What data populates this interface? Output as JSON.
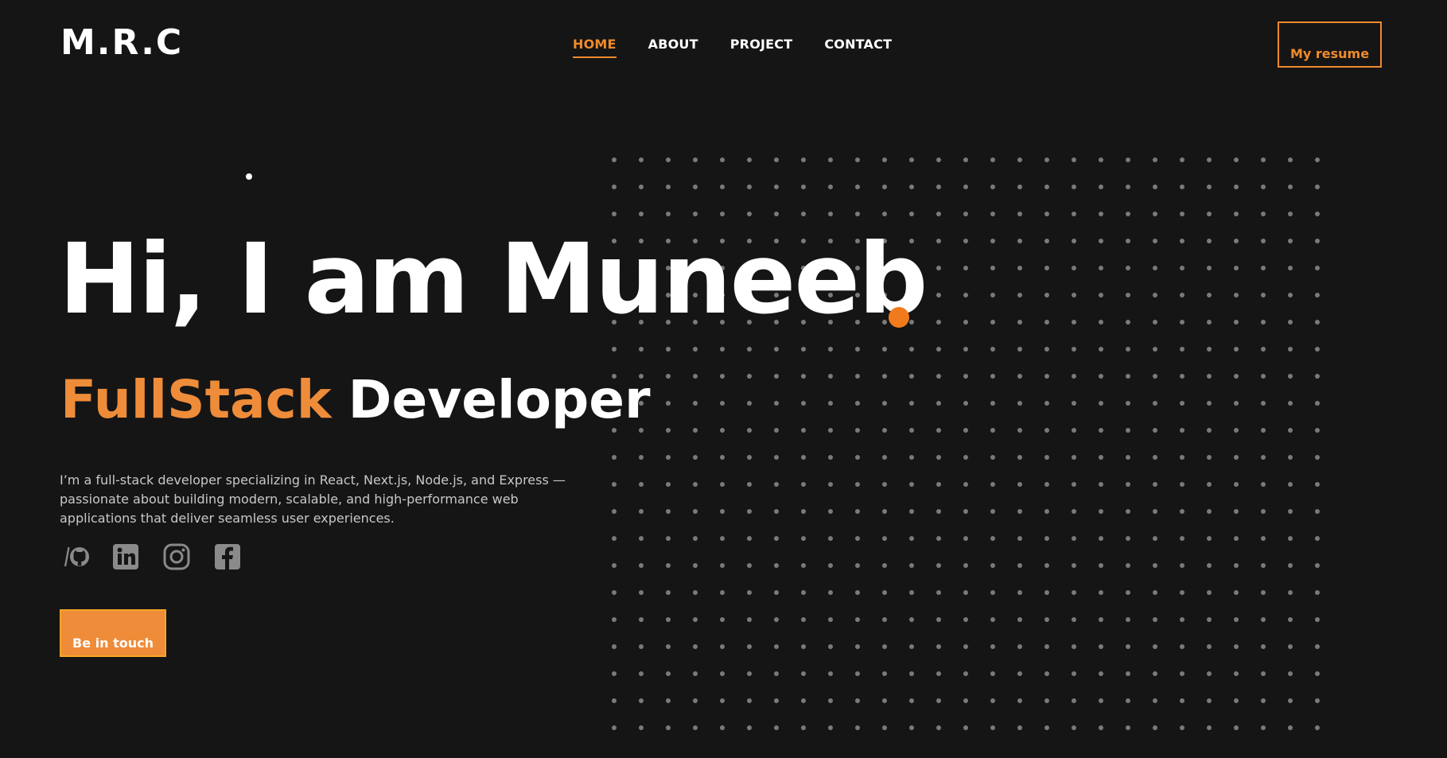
{
  "header": {
    "logo": "M.R.C",
    "nav": [
      {
        "label": "HOME",
        "active": true
      },
      {
        "label": "ABOUT",
        "active": false
      },
      {
        "label": "PROJECT",
        "active": false
      },
      {
        "label": "CONTACT",
        "active": false
      }
    ],
    "resume_label": "My resume"
  },
  "hero": {
    "title": "Hi, I am Muneeb",
    "subtitle_accent": "FullStack",
    "subtitle_plain": "Developer",
    "description": "I’m a full-stack developer specializing in React, Next.js, Node.js, and Express — passionate about building modern, scalable, and high-performance web applications that deliver seamless user experiences.",
    "socials": [
      {
        "icon": "github-icon"
      },
      {
        "icon": "linkedin-icon"
      },
      {
        "icon": "instagram-icon"
      },
      {
        "icon": "facebook-icon"
      }
    ],
    "cta_label": "Be in touch"
  },
  "colors": {
    "background": "#151516",
    "accent": "#ee8c3a",
    "accent_dot": "#f07a1c",
    "text": "#ffffff",
    "muted_text": "#c8c8c8",
    "icon_gray": "#8a8a8a",
    "grid_dot": "#7a7a7a"
  }
}
